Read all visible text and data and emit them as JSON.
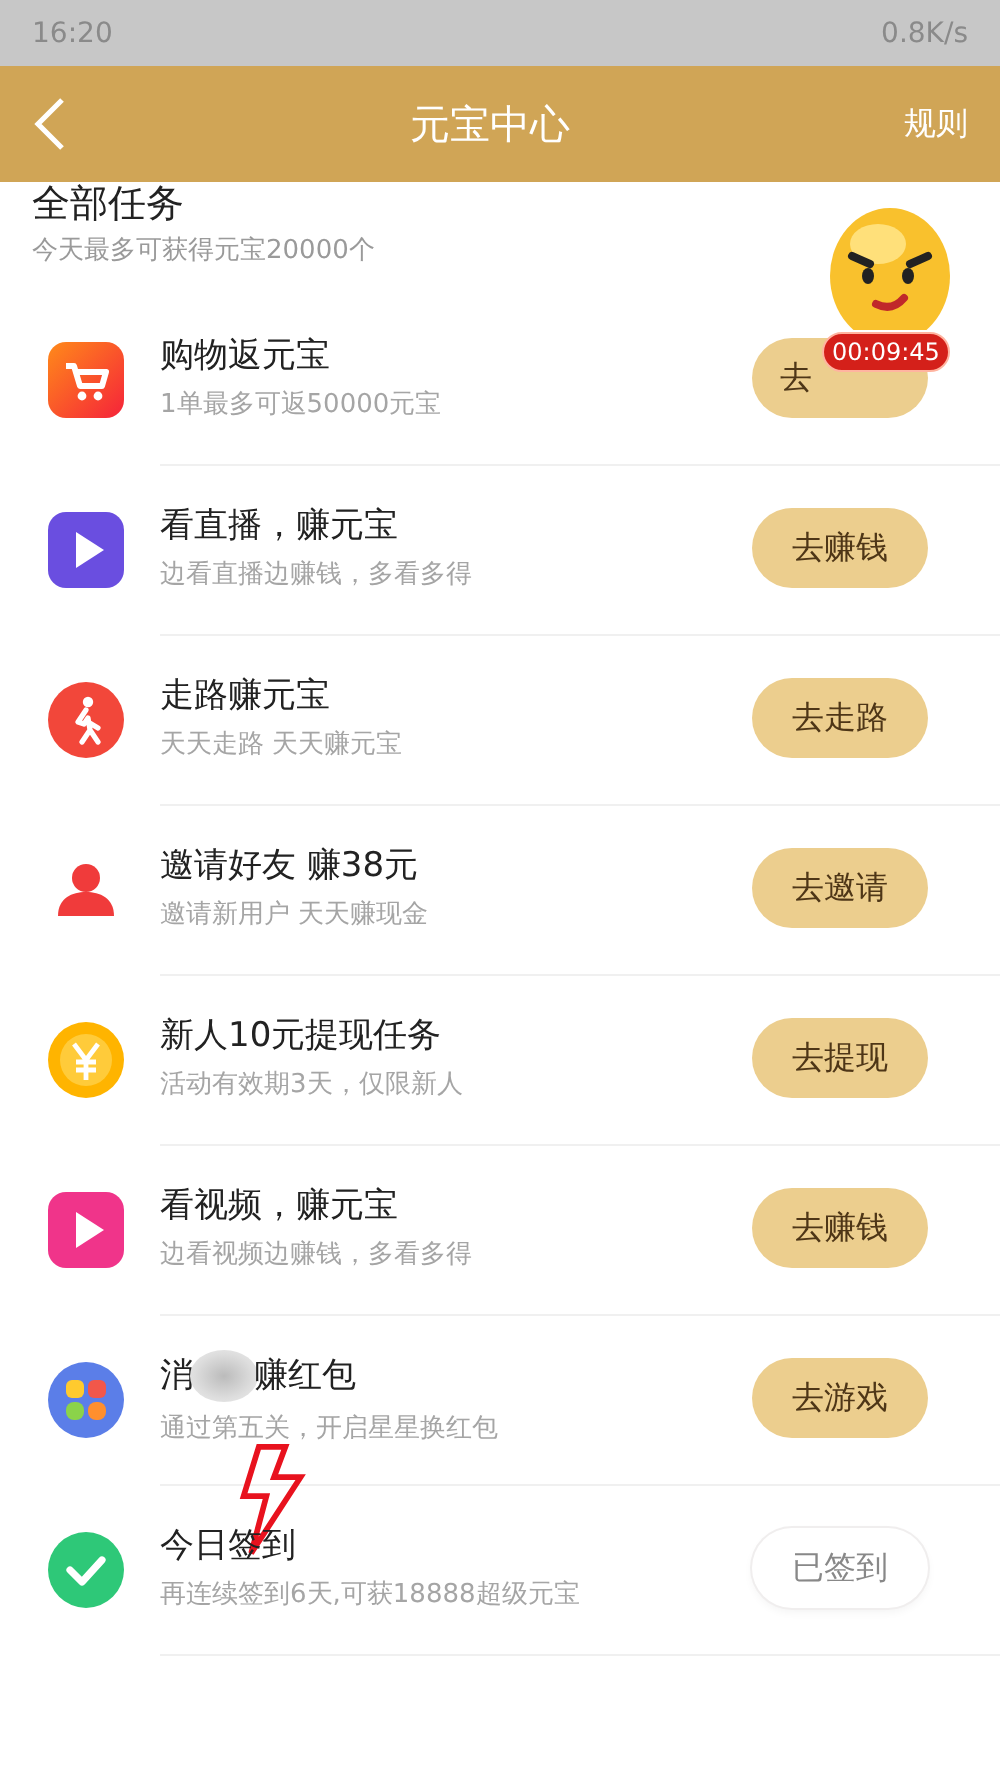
{
  "status_bar": {
    "time": "16:20",
    "speed": "0.8K/s"
  },
  "header": {
    "title": "元宝中心",
    "action": "规则"
  },
  "section": {
    "title": "全部任务",
    "subtitle": "今天最多可获得元宝20000个"
  },
  "floating_badge": {
    "timer": "00:09:45"
  },
  "tasks": [
    {
      "title": "购物返元宝",
      "subtitle": "1单最多可返50000元宝",
      "button": "去",
      "signed": false
    },
    {
      "title": "看直播，赚元宝",
      "subtitle": "边看直播边赚钱，多看多得",
      "button": "去赚钱",
      "signed": false
    },
    {
      "title": "走路赚元宝",
      "subtitle": "天天走路 天天赚元宝",
      "button": "去走路",
      "signed": false
    },
    {
      "title": "邀请好友 赚38元",
      "subtitle": "邀请新用户 天天赚现金",
      "button": "去邀请",
      "signed": false
    },
    {
      "title": "新人10元提现任务",
      "subtitle": "活动有效期3天，仅限新人",
      "button": "去提现",
      "signed": false
    },
    {
      "title": "看视频，赚元宝",
      "subtitle": "边看视频边赚钱，多看多得",
      "button": "去赚钱",
      "signed": false
    },
    {
      "title": "消",
      "title_end": "赚红包",
      "redacted": true,
      "subtitle": "通过第五关，开启星星换红包",
      "button": "去游戏",
      "signed": false
    },
    {
      "title": "今日签到",
      "subtitle": "再连续签到6天,可获18888超级元宝",
      "button": "已签到",
      "signed": true
    }
  ]
}
